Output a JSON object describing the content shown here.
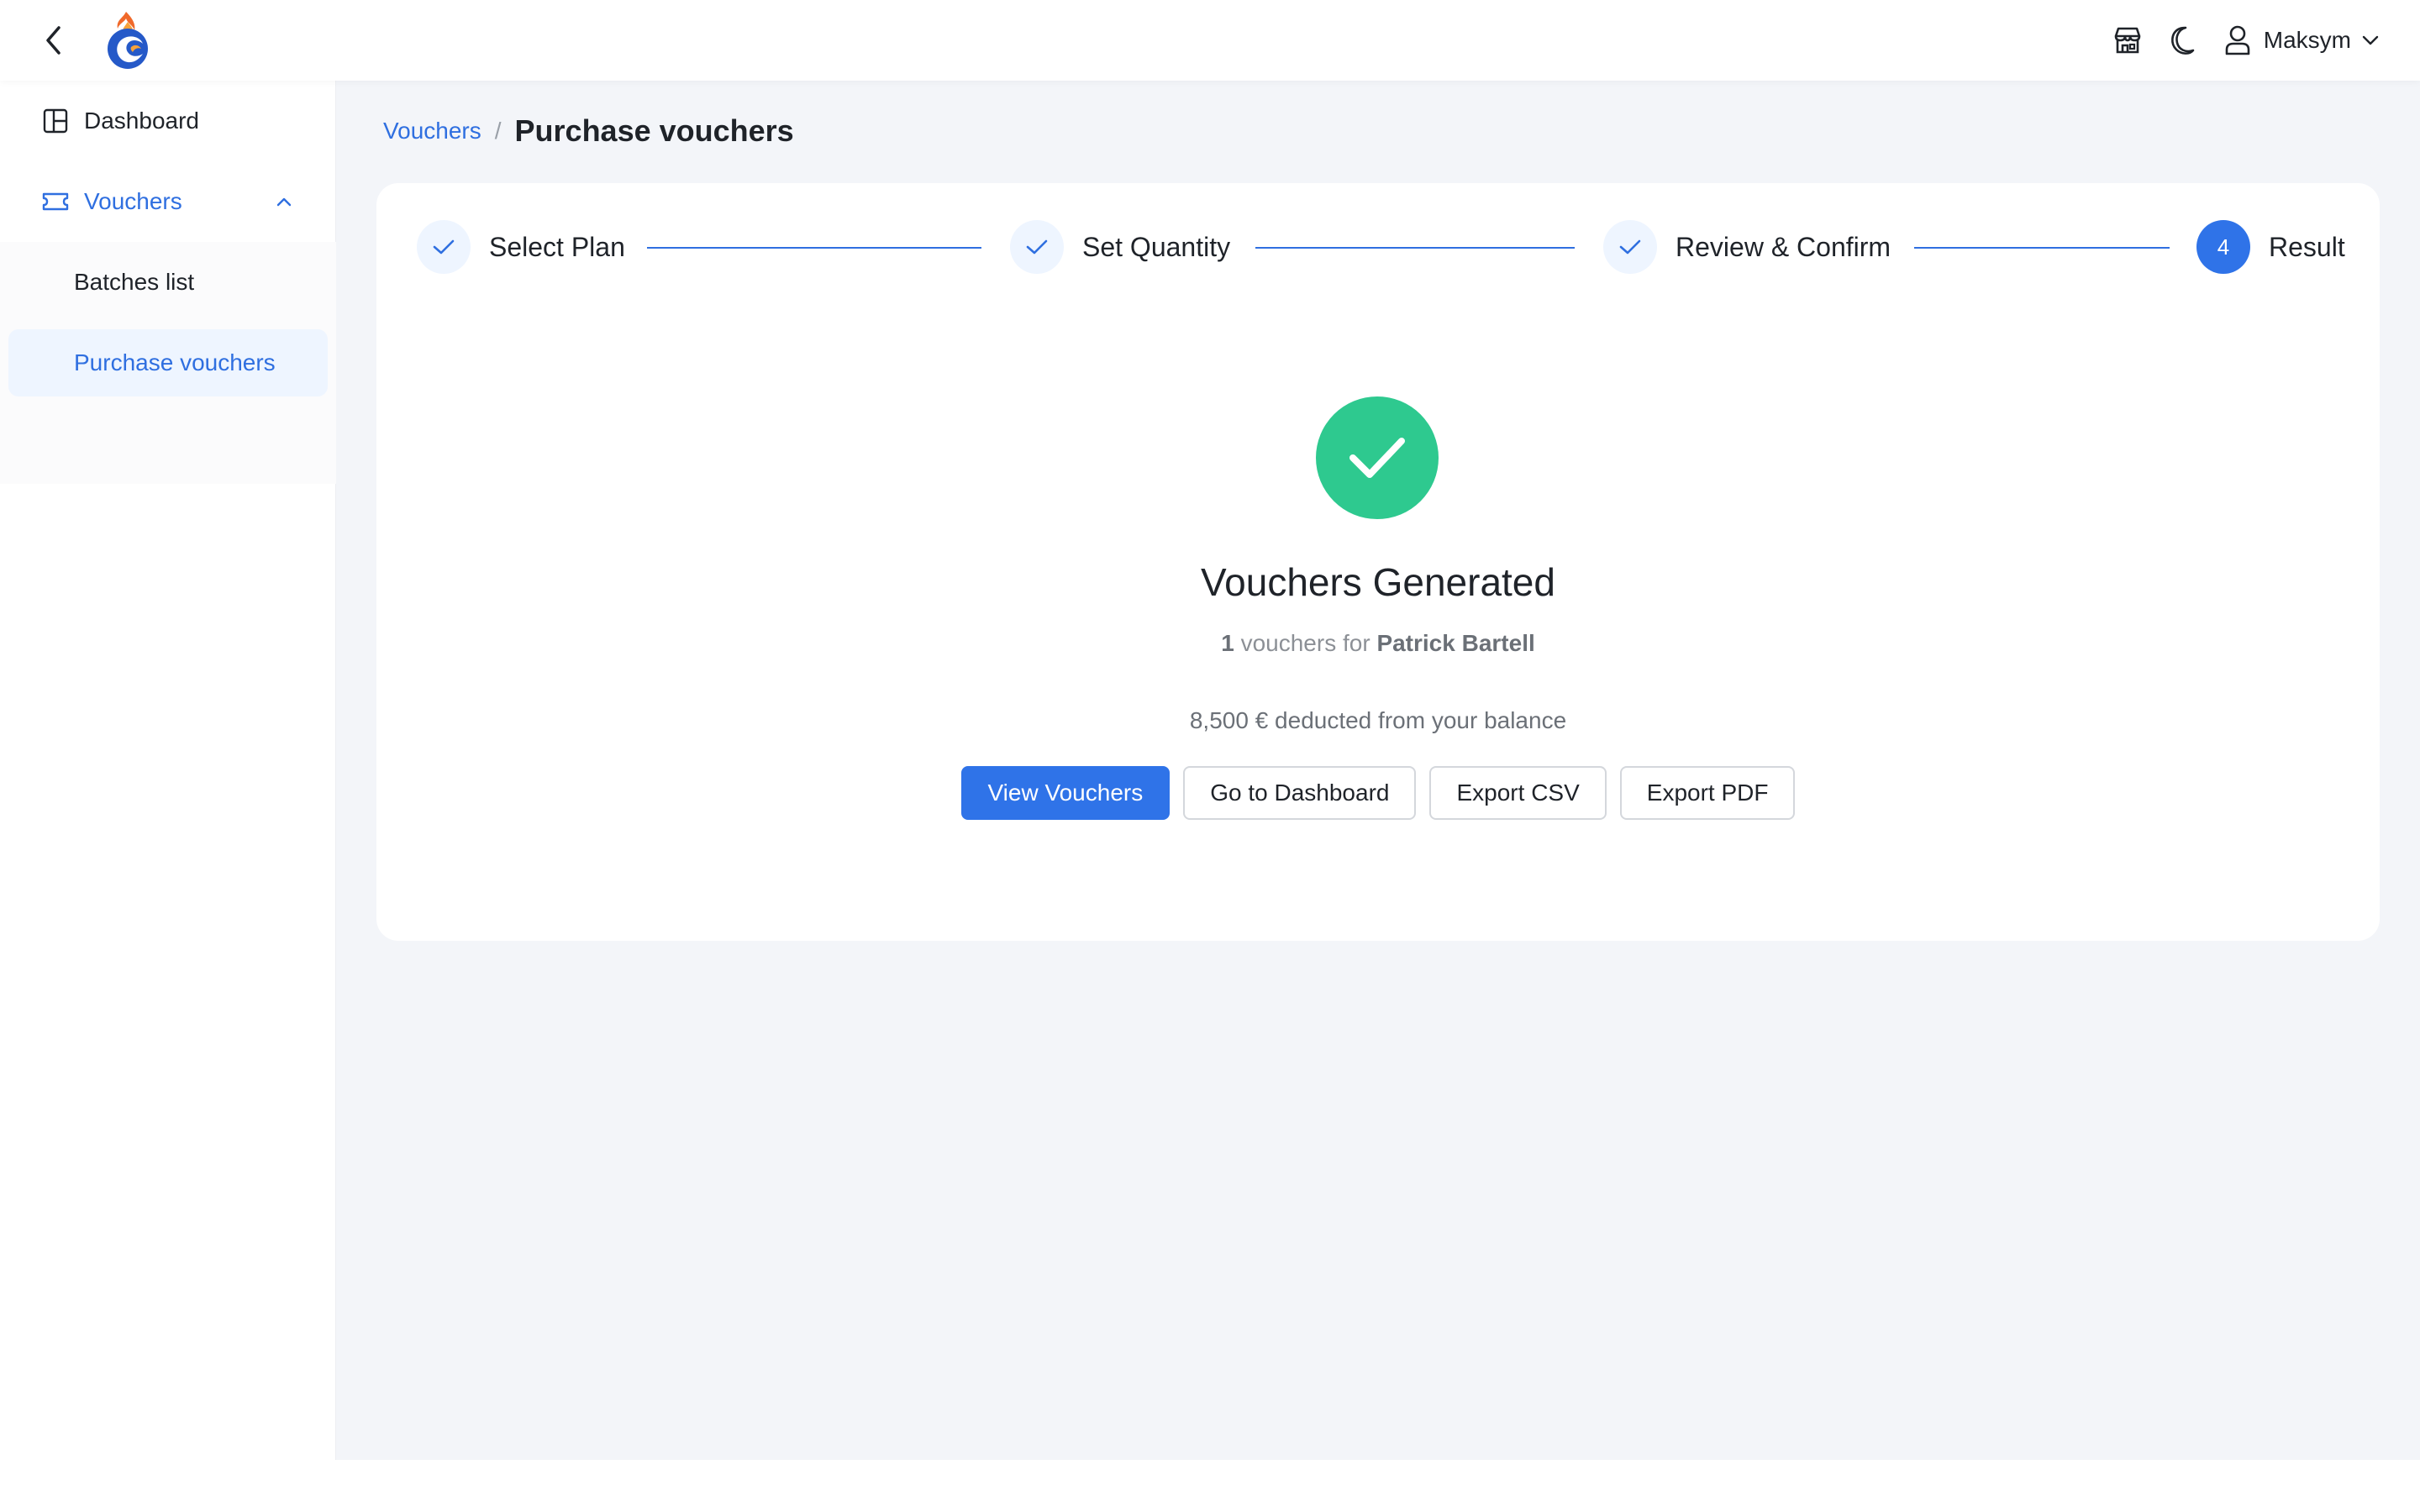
{
  "header": {
    "user_name": "Maksym",
    "icons": [
      "back-arrow-icon",
      "app-logo",
      "store-icon",
      "moon-icon",
      "user-icon",
      "chevron-down-icon"
    ]
  },
  "sidebar": {
    "items": [
      {
        "label": "Dashboard",
        "icon": "dashboard-icon"
      },
      {
        "label": "Vouchers",
        "icon": "ticket-icon",
        "expanded": true,
        "children": [
          {
            "label": "Batches list"
          },
          {
            "label": "Purchase vouchers",
            "active": true
          }
        ]
      }
    ]
  },
  "breadcrumb": {
    "parent": "Vouchers",
    "separator": "/",
    "current": "Purchase vouchers"
  },
  "steps": [
    {
      "title": "Select Plan",
      "status": "done"
    },
    {
      "title": "Set Quantity",
      "status": "done"
    },
    {
      "title": "Review & Confirm",
      "status": "done"
    },
    {
      "number": "4",
      "title": "Result",
      "status": "active"
    }
  ],
  "result": {
    "title": "Vouchers Generated",
    "count": "1",
    "count_suffix": "vouchers for",
    "recipient": "Patrick Bartell",
    "balance_text": "8,500 € deducted from your balance"
  },
  "actions": {
    "view_vouchers": "View Vouchers",
    "go_dashboard": "Go to Dashboard",
    "export_csv": "Export CSV",
    "export_pdf": "Export PDF"
  },
  "colors": {
    "primary": "#2f73e8",
    "success": "#2ec98f",
    "background": "#f3f5f9",
    "active_nav_bg": "#eef5ff"
  }
}
